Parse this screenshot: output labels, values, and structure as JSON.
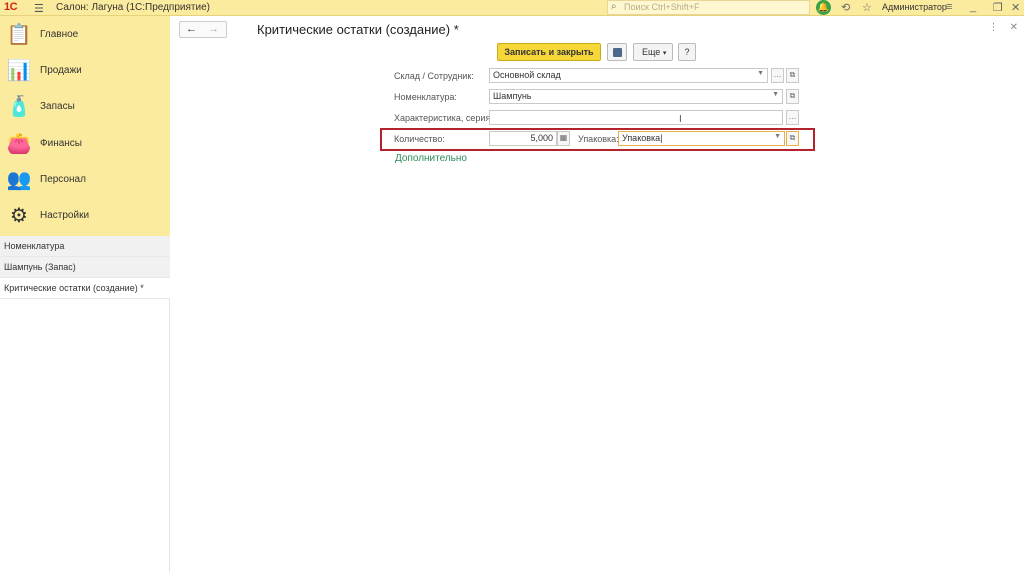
{
  "titlebar": {
    "logo": "1С",
    "app_title": "Салон: Лагуна  (1С:Предприятие)",
    "search_placeholder": "Поиск Ctrl+Shift+F",
    "user": "Администратор"
  },
  "sidebar": {
    "sections": [
      {
        "label": "Главное",
        "icon": "clipboard-icon"
      },
      {
        "label": "Продажи",
        "icon": "chart-icon"
      },
      {
        "label": "Запасы",
        "icon": "products-icon"
      },
      {
        "label": "Финансы",
        "icon": "wallet-icon"
      },
      {
        "label": "Персонал",
        "icon": "people-icon"
      },
      {
        "label": "Настройки",
        "icon": "gear-icon"
      }
    ],
    "open_windows": [
      {
        "label": "Номенклатура"
      },
      {
        "label": "Шампунь (Запас)"
      },
      {
        "label": "Критические остатки (создание) *"
      }
    ]
  },
  "form": {
    "title": "Критические остатки (создание) *",
    "save_close": "Записать и закрыть",
    "more": "Еще",
    "help": "?",
    "fields": {
      "warehouse_label": "Склад / Сотрудник:",
      "warehouse_value": "Основной склад",
      "nomenclature_label": "Номенклатура:",
      "nomenclature_value": "Шампунь",
      "characteristic_label": "Характеристика, серия:",
      "characteristic_value": "",
      "quantity_label": "Количество:",
      "quantity_value": "5,000",
      "package_label": "Упаковка:",
      "package_value": "Упаковка"
    },
    "additional_link": "Дополнительно"
  },
  "colors": {
    "accent_yellow": "#f6d739",
    "panel_yellow": "#fbeb9e",
    "highlight_red": "#b4232b",
    "link_green": "#2e8b57"
  }
}
